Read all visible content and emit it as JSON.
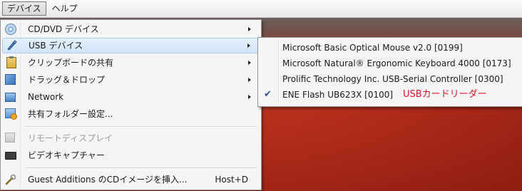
{
  "menubar": {
    "items": [
      "デバイス",
      "ヘルプ"
    ]
  },
  "devices_menu": {
    "items": [
      {
        "label": "CD/DVD デバイス",
        "icon": "cd-dvd-icon",
        "submenu": true
      },
      {
        "label": "USB デバイス",
        "icon": "usb-icon",
        "submenu": true,
        "highlighted": true
      },
      {
        "label": "クリップボードの共有",
        "icon": "clipboard-icon",
        "submenu": true
      },
      {
        "label": "ドラッグ＆ドロップ",
        "icon": "drag-drop-icon",
        "submenu": true
      },
      {
        "label": "Network",
        "icon": "network-icon",
        "submenu": true
      },
      {
        "label": "共有フォルダー設定...",
        "icon": "shared-folder-icon"
      },
      {
        "label": "リモートディスプレイ",
        "icon": "remote-display-icon",
        "disabled": true
      },
      {
        "label": "ビデオキャプチャー",
        "icon": "video-capture-icon"
      },
      {
        "label": "Guest Additions のCDイメージを挿入...",
        "icon": "guest-additions-icon",
        "shortcut": "Host+D"
      }
    ]
  },
  "usb_submenu": {
    "items": [
      {
        "label": "Microsoft Basic Optical Mouse v2.0 [0199]",
        "checked": false
      },
      {
        "label": "Microsoft Natural® Ergonomic Keyboard 4000 [0173]",
        "checked": false
      },
      {
        "label": "Prolific Technology Inc. USB-Serial Controller [0300]",
        "checked": false
      },
      {
        "label": "ENE Flash UB623X [0100]",
        "checked": true
      }
    ],
    "check_mark": "✔",
    "annotation": "USBカードリーダー",
    "annotation_color": "#e0152a"
  },
  "colors": {
    "highlight": "#cfe4f7",
    "desktop": "#b02c1a"
  }
}
